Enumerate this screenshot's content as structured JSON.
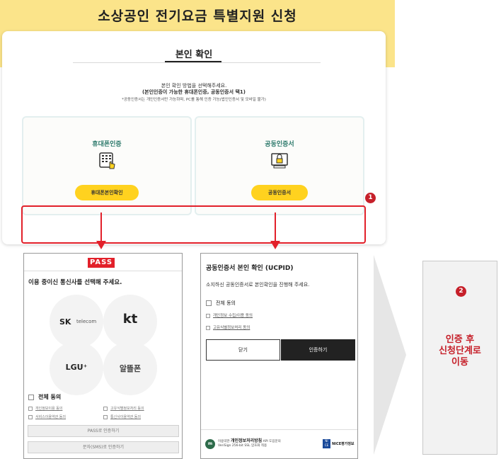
{
  "banner": {
    "title": "소상공인 전기요금 특별지원 신청"
  },
  "card": {
    "title": "본인 확인",
    "desc1": "본인 확인 방법을 선택해주세요.",
    "desc2": "(본인인증이 가능한 휴대폰인증, 공동인증서 택1)",
    "desc3": "*공동인증서는 개인인증서만 가능하며, PC를 통해 인증 가능(법인인증서 및 모바일 불가)",
    "phone": {
      "label": "휴대폰인증",
      "button": "휴대폰본인확인",
      "icon": "phone-keypad-icon"
    },
    "cert": {
      "label": "공동인증서",
      "button": "공동인증서",
      "icon": "certificate-lock-icon"
    },
    "badge": "1"
  },
  "pass": {
    "logo": "PASS",
    "instruction": "이용 중이신 통신사를 선택해 주세요.",
    "carriers": {
      "sk": "SK",
      "sk_sub": "telecom",
      "kt": "kt",
      "lgu": "LGU⁺",
      "alt": "알뜰폰"
    },
    "agree_all": "전체 동의",
    "terms": [
      "개인정보이용 동의",
      "고유식별정보처리 동의",
      "서비스이용약관 동의",
      "통신사이용약관 동의"
    ],
    "btn_pass": "PASS로 인증하기",
    "btn_sms": "문자(SMS)로 인증하기"
  },
  "ucpid": {
    "title": "공동인증서 본인 확인 (UCPID)",
    "subtitle": "소지하신 공동인증서로 본인확인을 진행해 주세요.",
    "agree_all": "전체 동의",
    "terms": [
      "개인정보 수집/이용 동의",
      "고유식별정보처리 동의"
    ],
    "btn_close": "닫기",
    "btn_confirm": "인증하기",
    "footer_agency": "개인정보처리방침",
    "footer_prefix": "이용약관",
    "footer_extra": "API 도입문의",
    "footer_sub": "VeriSign 256-bit SSL 암호화 적용",
    "nice_logo": "NICE",
    "nice_name": "NICE평가정보"
  },
  "step": {
    "badge": "2",
    "text_line1": "인증 후",
    "text_line2": "신청단계로",
    "text_line3": "이동"
  },
  "colors": {
    "banner": "#fbe48a",
    "accent_red": "#e2202a",
    "button_yellow": "#ffd21f",
    "label_green": "#2d7a6c"
  }
}
